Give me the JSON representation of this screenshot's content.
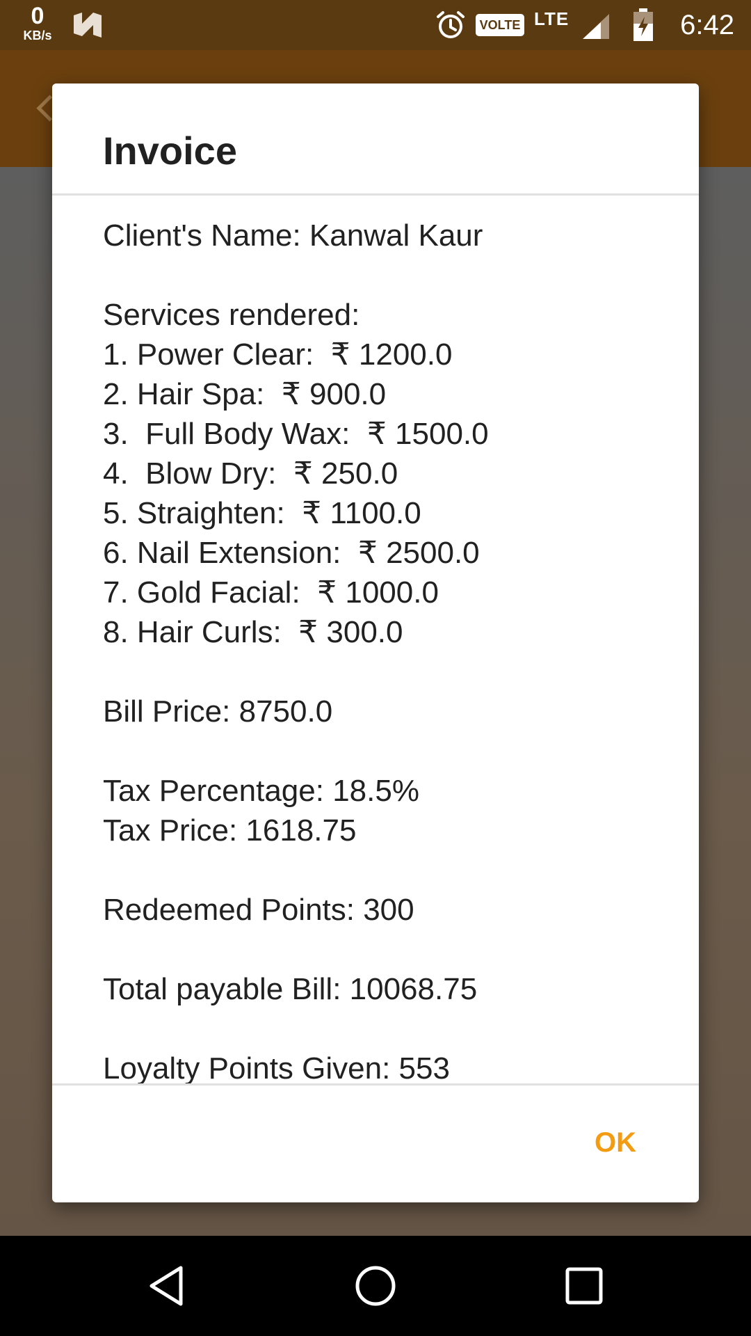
{
  "status_bar": {
    "net_speed_value": "0",
    "net_speed_unit": "KB/s",
    "volte_label": "VOLTE",
    "network_type": "LTE",
    "time": "6:42",
    "icons": [
      "n-notification-icon",
      "alarm-icon",
      "signal-icon",
      "battery-charging-icon"
    ]
  },
  "dialog": {
    "title": "Invoice",
    "client_line": "Client's Name: Kanwal Kaur",
    "services_header": "Services rendered:",
    "services": [
      "1. Power Clear:  ₹ 1200.0",
      "2. Hair Spa:  ₹ 900.0",
      "3.  Full Body Wax:  ₹ 1500.0",
      "4.  Blow Dry:  ₹ 250.0",
      "5. Straighten:  ₹ 1100.0",
      "6. Nail Extension:  ₹ 2500.0",
      "7. Gold Facial:  ₹ 1000.0",
      "8. Hair Curls:  ₹ 300.0"
    ],
    "bill_price": "Bill Price: 8750.0",
    "tax_percentage": "Tax Percentage: 18.5%",
    "tax_price": "Tax Price: 1618.75",
    "redeemed_points": "Redeemed Points: 300",
    "total_payable": "Total payable Bill: 10068.75",
    "loyalty_points": "Loyalty Points Given: 553",
    "ok_label": "OK"
  },
  "nav_bar": {
    "icons": [
      "back-icon",
      "home-icon",
      "recents-icon"
    ]
  },
  "colors": {
    "status_bar": "#5a3a10",
    "app_bar": "#6b400e",
    "accent": "#f39c12",
    "dialog_text": "#212121"
  }
}
